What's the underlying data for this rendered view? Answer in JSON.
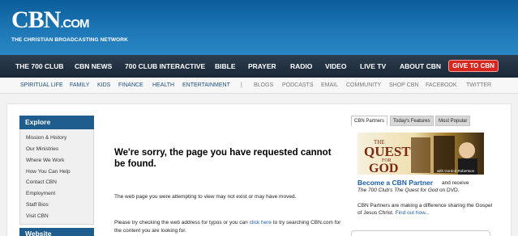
{
  "header": {
    "logo_text": "CBN",
    "logo_suffix": ".COM",
    "tagline": "THE CHRISTIAN BROADCASTING NETWORK"
  },
  "main_nav": [
    "THE 700 CLUB",
    "CBN NEWS",
    "700 CLUB INTERACTIVE",
    "BIBLE",
    "PRAYER",
    "RADIO",
    "VIDEO",
    "LIVE TV",
    "ABOUT CBN"
  ],
  "give_button": "GIVE TO CBN",
  "sub_nav": {
    "left": [
      "SPIRITUAL LIFE",
      "FAMILY",
      "KIDS",
      "FINANCE",
      "HEALTH",
      "ENTERTAINMENT"
    ],
    "separator": "|",
    "right": [
      "BLOGS",
      "PODCASTS",
      "EMAIL",
      "COMMUNITY",
      "SHOP CBN",
      "FACEBOOK",
      "TWITTER"
    ]
  },
  "sidebar": {
    "heading": "Explore",
    "links": [
      "Mission & History",
      "Our Ministries",
      "Where We Work",
      "How You Can Help",
      "Contact CBN",
      "Employment",
      "Staff Bios",
      "Visit CBN"
    ],
    "next_heading": "Website"
  },
  "error": {
    "title": "We're sorry, the page you have requested cannot be found.",
    "p1": "The web page you were attempting to view may not exist or may have moved.",
    "p2_before": "Please try checking the web address for typos or you can ",
    "p2_link": "click here",
    "p2_after": " to try searching CBN.com for the content you are looking for."
  },
  "right": {
    "tabs": [
      "CBN Partners",
      "Today's Features",
      "Most Popular"
    ],
    "promo": {
      "the": "THE",
      "quest": "QUEST",
      "for": "FOR",
      "god": "GOD",
      "byline": "with Gordon Robertson"
    },
    "partner_title": "Become a CBN Partner",
    "partner_rest": "and receive",
    "partner_line2_a": "The 700 Club's ",
    "partner_line2_b": "The Quest for God",
    "partner_line2_c": " on DVD.",
    "partner_line3": "CBN Partners are making a difference sharing the Gospel of Jesus Christ. ",
    "partner_link": "Find out how..."
  },
  "colors": {
    "header_blue": "#1f79b8",
    "nav_dark": "#1a2736",
    "give_red": "#d7261e",
    "sidebar_blue": "#1f5d8e",
    "link_blue": "#1c5ea8"
  }
}
